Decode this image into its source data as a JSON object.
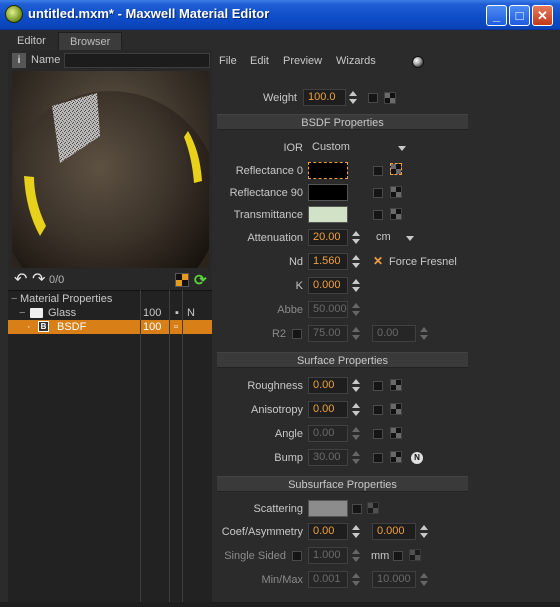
{
  "window": {
    "title": "untitled.mxm* - Maxwell Material Editor",
    "buttons": {
      "minimize": "_",
      "maximize": "□",
      "close": "✕"
    }
  },
  "tabs": [
    {
      "label": "Editor"
    },
    {
      "label": "Browser"
    }
  ],
  "left": {
    "name_label": "Name",
    "name_value": "",
    "undo_count": "0/0",
    "tree": [
      {
        "label": "Material Properties",
        "value": "",
        "mark": ""
      },
      {
        "label": "Glass",
        "value": "100",
        "mark": "N"
      },
      {
        "label": "BSDF",
        "value": "100",
        "mark": ""
      }
    ]
  },
  "menu": {
    "file": "File",
    "edit": "Edit",
    "preview": "Preview",
    "wizards": "Wizards"
  },
  "weight": {
    "label": "Weight",
    "value": "100.0"
  },
  "bsdf": {
    "header": "BSDF Properties",
    "ior_label": "IOR",
    "ior_value": "Custom",
    "reflectance0_label": "Reflectance 0",
    "reflectance90_label": "Reflectance 90",
    "transmittance_label": "Transmittance",
    "attenuation_label": "Attenuation",
    "attenuation_value": "20.00",
    "attenuation_unit": "cm",
    "nd_label": "Nd",
    "nd_value": "1.560",
    "force_fresnel_label": "Force Fresnel",
    "k_label": "K",
    "k_value": "0.000",
    "abbe_label": "Abbe",
    "abbe_value": "50.000",
    "r2_label": "R2",
    "r2_value_a": "75.00",
    "r2_value_b": "0.00",
    "colors": {
      "reflectance0": "#000000",
      "reflectance90": "#000000",
      "transmittance": "#d2e2c6"
    }
  },
  "surface": {
    "header": "Surface Properties",
    "roughness_label": "Roughness",
    "roughness_value": "0.00",
    "anisotropy_label": "Anisotropy",
    "anisotropy_value": "0.00",
    "angle_label": "Angle",
    "angle_value": "0.00",
    "bump_label": "Bump",
    "bump_value": "30.00"
  },
  "subsurface": {
    "header": "Subsurface Properties",
    "scattering_label": "Scattering",
    "scattering_color": "#8c8c8c",
    "coef_label": "Coef/Asymmetry",
    "coef_value": "0.00",
    "asym_value": "0.000",
    "single_sided_label": "Single Sided",
    "single_sided_value": "1.000",
    "single_sided_unit": "mm",
    "minmax_label": "Min/Max",
    "min_value": "0.001",
    "max_value": "10.000"
  },
  "accent_color": "#d97f17",
  "value_color": "#f0a040"
}
